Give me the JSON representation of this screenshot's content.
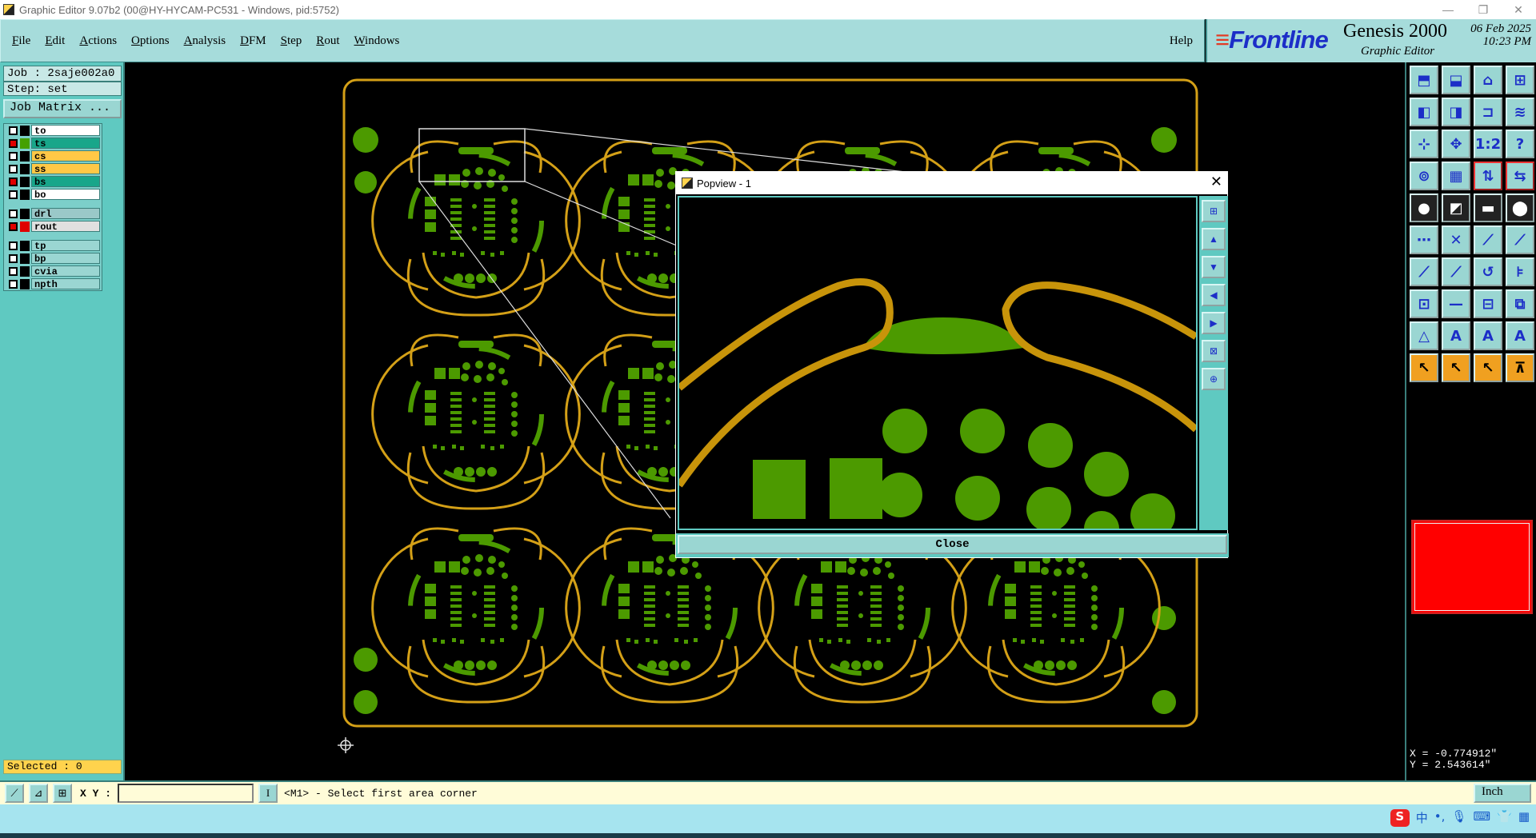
{
  "window": {
    "title": "Graphic Editor 9.07b2 (00@HY-HYCAM-PC531 - Windows, pid:5752)",
    "controls": [
      "—",
      "❐",
      "✕"
    ]
  },
  "menu": {
    "items": [
      "File",
      "Edit",
      "Actions",
      "Options",
      "Analysis",
      "DFM",
      "Step",
      "Rout",
      "Windows"
    ],
    "help": "Help"
  },
  "brand": {
    "logo": "Frontline",
    "product": "Genesis 2000",
    "subtitle": "Graphic Editor",
    "date": "06 Feb 2025",
    "time": "10:23 PM"
  },
  "job": {
    "job_label": "Job : 2saje002a0",
    "step_label": "Step: set",
    "matrix_button": "Job Matrix ..."
  },
  "layers": [
    {
      "name": "to",
      "swatch": "#000000",
      "bg": "#ffffff",
      "checked": false
    },
    {
      "name": "ts",
      "swatch": "#44a000",
      "bg": "#18a68a",
      "checked": true
    },
    {
      "name": "cs",
      "swatch": "#000000",
      "bg": "#ffc846",
      "checked": false
    },
    {
      "name": "ss",
      "swatch": "#000000",
      "bg": "#ffc846",
      "checked": false
    },
    {
      "name": "bs",
      "swatch": "#000000",
      "bg": "#18a68a",
      "checked": true
    },
    {
      "name": "bo",
      "swatch": "#000000",
      "bg": "#ffffff",
      "checked": false
    },
    {
      "name": "drl",
      "swatch": "#000000",
      "bg": "#9ac8c8",
      "checked": false
    },
    {
      "name": "rout",
      "swatch": "#e00000",
      "bg": "#e0e0e0",
      "checked": true
    },
    {
      "name": "tp",
      "swatch": "#000000",
      "bg": "#9ad6d2",
      "checked": false
    },
    {
      "name": "bp",
      "swatch": "#000000",
      "bg": "#9ad6d2",
      "checked": false
    },
    {
      "name": "cvia",
      "swatch": "#000000",
      "bg": "#9ad6d2",
      "checked": false
    },
    {
      "name": "npth",
      "swatch": "#000000",
      "bg": "#9ad6d2",
      "checked": false
    }
  ],
  "selected": "Selected : 0",
  "popup": {
    "title": "Popview - 1",
    "close_label": "Close"
  },
  "coords": {
    "x": "X = -0.774912\"",
    "y": "Y = 2.543614\""
  },
  "status": {
    "xy_label": "X Y :",
    "xy_value": "",
    "prompt": "<M1> - Select first area corner",
    "unit": "Inch"
  },
  "colors": {
    "board_outline": "#d4a017",
    "copper": "#4c9a00",
    "panel": "#5fc9c1",
    "menu": "#a6dcdb",
    "active_color": "#ff0000"
  }
}
